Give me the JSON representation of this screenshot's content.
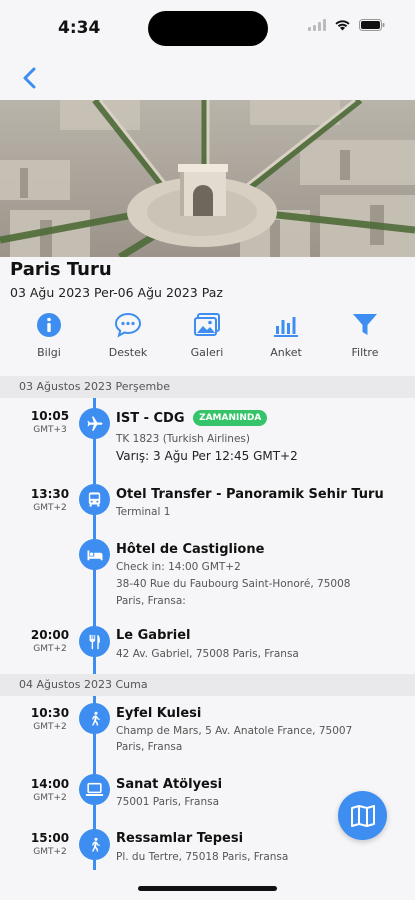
{
  "status_bar": {
    "time": "4:34"
  },
  "trip": {
    "title": "Paris Turu",
    "dates": "03 Ağu 2023 Per-06 Ağu 2023 Paz"
  },
  "actions": [
    {
      "label": "Bilgi",
      "icon": "info-icon"
    },
    {
      "label": "Destek",
      "icon": "chat-icon"
    },
    {
      "label": "Galeri",
      "icon": "gallery-icon"
    },
    {
      "label": "Anket",
      "icon": "poll-icon"
    },
    {
      "label": "Filtre",
      "icon": "filter-icon"
    }
  ],
  "days": [
    {
      "label": "03 Ağustos 2023 Perşembe"
    },
    {
      "label": "04 Ağustos 2023 Cuma"
    }
  ],
  "events": [
    {
      "time": "10:05",
      "tz": "GMT+3",
      "icon": "plane-icon",
      "title": "IST  - CDG",
      "badge": "ZAMANINDA",
      "line1": "TK 1823 (Turkish Airlines)",
      "arrival_label": "Varış:",
      "arrival_value": "3 Ağu Per 12:45 GMT+2"
    },
    {
      "time": "13:30",
      "tz": "GMT+2",
      "icon": "bus-icon",
      "title": "Otel Transfer - Panoramik Sehir Turu",
      "line1": "Terminal 1"
    },
    {
      "time": "",
      "tz": "",
      "icon": "bed-icon",
      "title": "Hôtel de Castiglione",
      "line1": "Check in: 14:00 GMT+2",
      "line2": "38-40 Rue du Faubourg Saint-Honoré, 75008",
      "line3": "Paris, Fransa:"
    },
    {
      "time": "20:00",
      "tz": "GMT+2",
      "icon": "restaurant-icon",
      "title": "Le Gabriel",
      "line1": "42 Av. Gabriel, 75008 Paris, Fransa"
    },
    {
      "time": "10:30",
      "tz": "GMT+2",
      "icon": "walking-icon",
      "title": "Eyfel Kulesi",
      "line1": "Champ de Mars, 5 Av. Anatole France, 75007",
      "line2": "Paris, Fransa"
    },
    {
      "time": "14:00",
      "tz": "GMT+2",
      "icon": "laptop-icon",
      "title": "Sanat Atölyesi",
      "line1": "75001 Paris, Fransa"
    },
    {
      "time": "15:00",
      "tz": "GMT+2",
      "icon": "walking-icon",
      "title": "Ressamlar Tepesi",
      "line1": "Pl. du Tertre, 75018 Paris, Fransa"
    }
  ],
  "colors": {
    "accent": "#3d8ef0",
    "badge": "#35c46a",
    "section_bg": "#e9e9ec"
  }
}
